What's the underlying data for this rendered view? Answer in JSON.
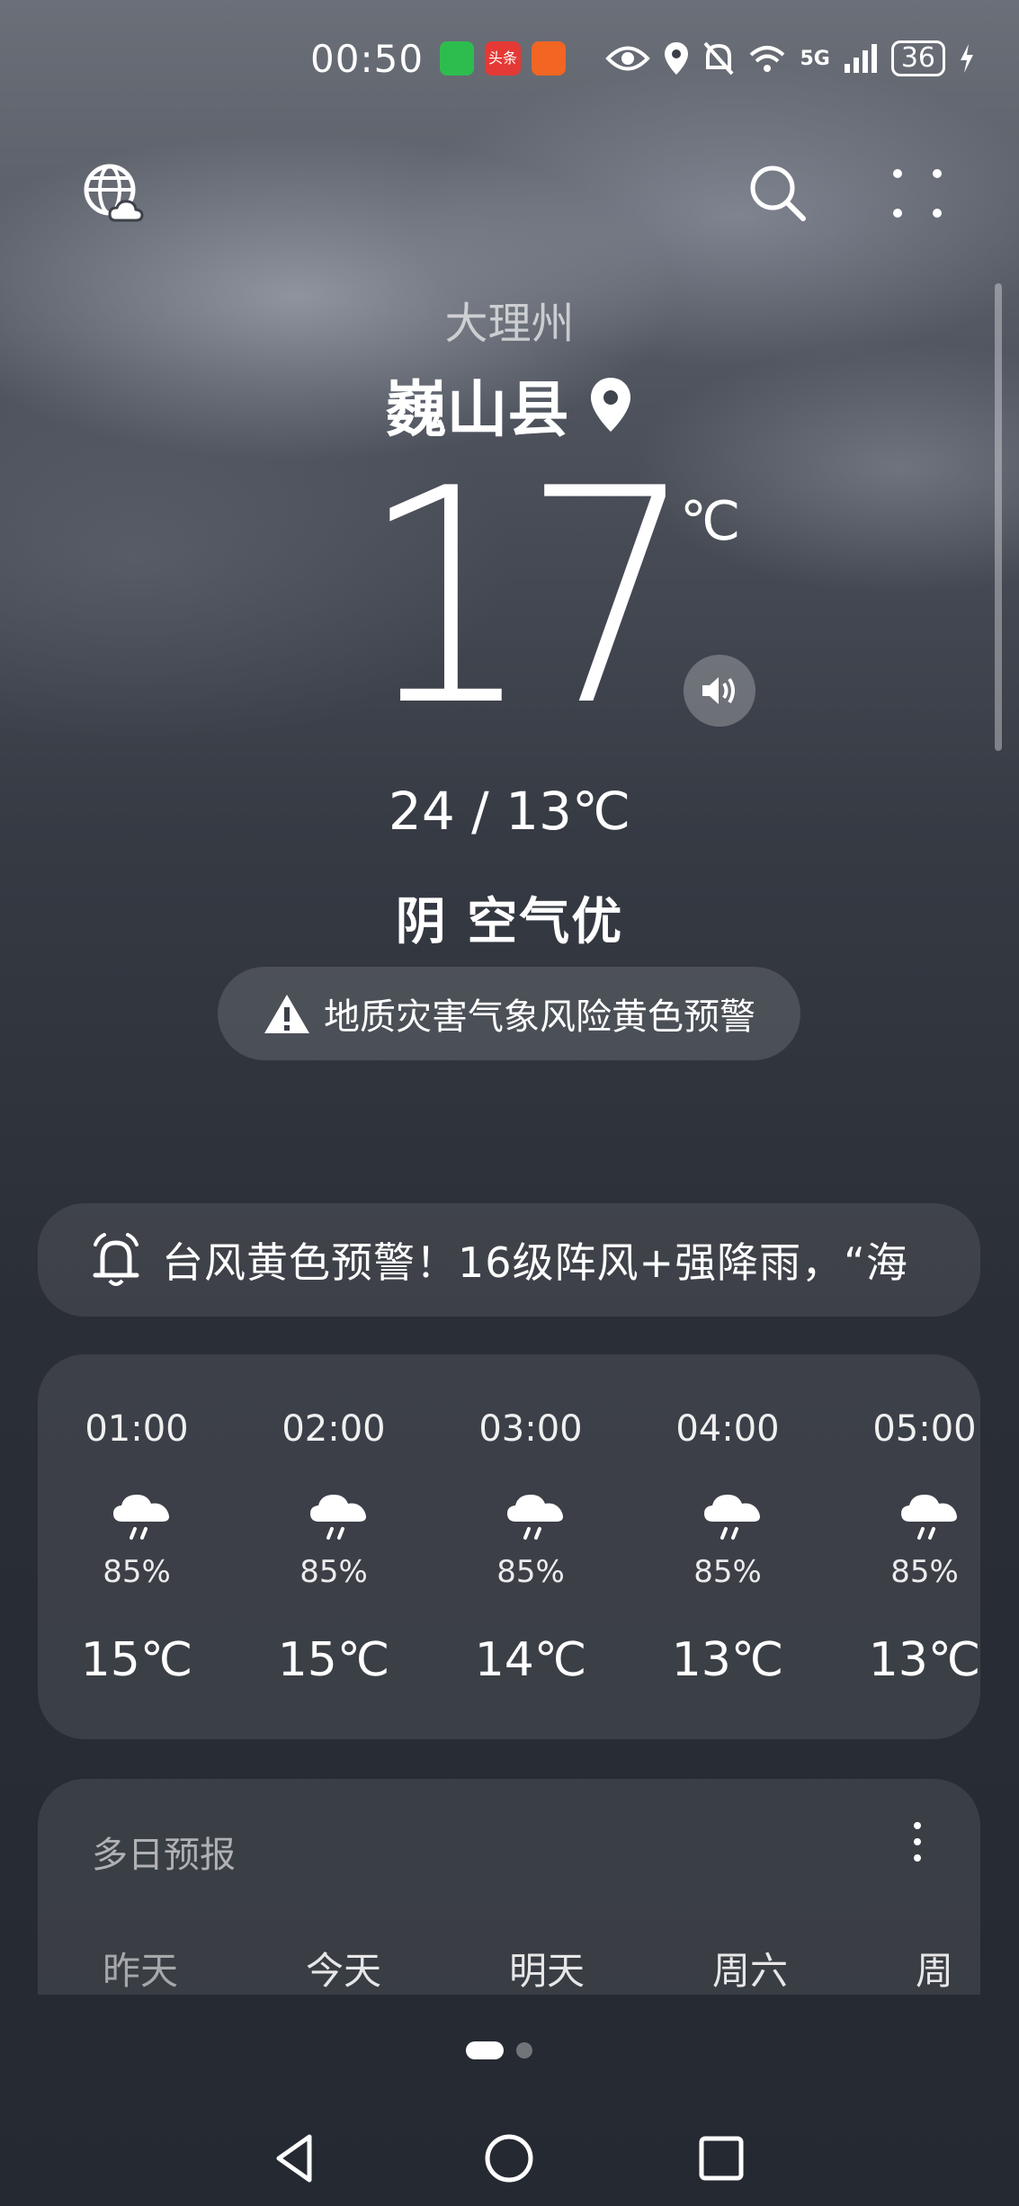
{
  "status_bar": {
    "time": "00:50",
    "app_icons": [
      {
        "name": "wechat-icon",
        "color": "#2dbd4e"
      },
      {
        "name": "toutiao-icon",
        "color": "#e53935",
        "label": "头条"
      },
      {
        "name": "app-icon",
        "color": "#f26522"
      }
    ],
    "network": "5G",
    "battery": "36"
  },
  "location": {
    "region": "大理州",
    "city": "巍山县"
  },
  "current": {
    "temperature": "17",
    "unit": "℃",
    "range": "24 / 13℃",
    "condition": "阴  空气优",
    "alert": "地质灾害气象风险黄色预警"
  },
  "typhoon_alert": "台风黄色预警！16级阵风+强降雨，“海",
  "hourly": [
    {
      "time": "01:00",
      "precip": "85%",
      "temp": "15℃"
    },
    {
      "time": "02:00",
      "precip": "85%",
      "temp": "15℃"
    },
    {
      "time": "03:00",
      "precip": "85%",
      "temp": "14℃"
    },
    {
      "time": "04:00",
      "precip": "85%",
      "temp": "13℃"
    },
    {
      "time": "05:00",
      "precip": "85%",
      "temp": "13℃"
    }
  ],
  "multi_day": {
    "title": "多日预报",
    "days": [
      "昨天",
      "今天",
      "明天",
      "周六",
      "周日"
    ]
  }
}
